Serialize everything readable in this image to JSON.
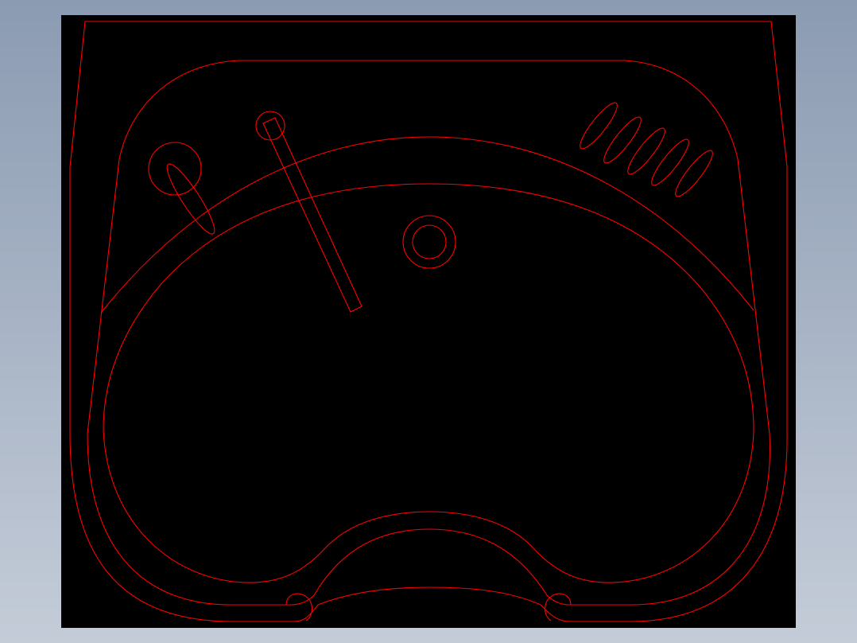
{
  "background": {
    "gradient_top": "#8b9bb2",
    "gradient_bottom": "#c4ccd8"
  },
  "canvas": {
    "fill": "#000000",
    "stroke": "#ff0000"
  },
  "drawing": {
    "description_parts": [
      "outer-housing",
      "inner-rounded-frame",
      "lens-band",
      "inner-bowl",
      "nose-bridge",
      "left-circle-slot",
      "diagonal-rod",
      "center-ring",
      "vent-slots"
    ],
    "vent_slot_count": 5
  }
}
